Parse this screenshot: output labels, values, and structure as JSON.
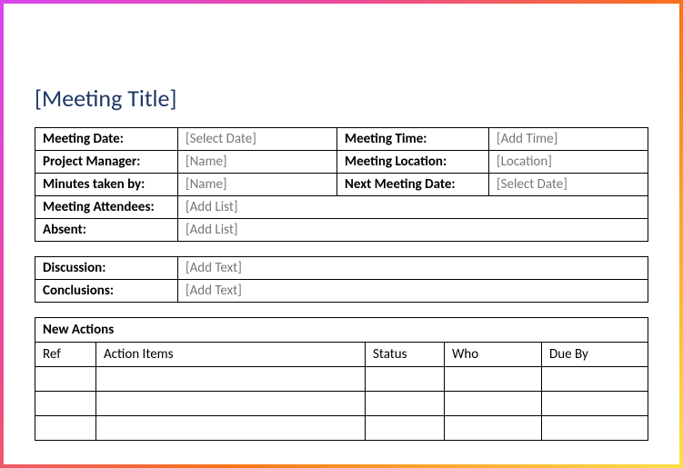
{
  "faint": {
    "line1": "",
    "line2": ""
  },
  "title": "[Meeting Title]",
  "details": {
    "meeting_date_label": "Meeting Date:",
    "meeting_date_value": "[Select Date]",
    "meeting_time_label": "Meeting Time:",
    "meeting_time_value": "[Add Time]",
    "project_manager_label": "Project Manager:",
    "project_manager_value": "[Name]",
    "meeting_location_label": "Meeting Location:",
    "meeting_location_value": "[Location]",
    "minutes_taken_by_label": "Minutes taken by:",
    "minutes_taken_by_value": "[Name]",
    "next_meeting_date_label": "Next Meeting Date:",
    "next_meeting_date_value": "[Select Date]",
    "meeting_attendees_label": "Meeting Attendees:",
    "meeting_attendees_value": "[Add List]",
    "absent_label": "Absent:",
    "absent_value": "[Add List]"
  },
  "discussion": {
    "discussion_label": "Discussion:",
    "discussion_value": "[Add Text]",
    "conclusions_label": "Conclusions:",
    "conclusions_value": "[Add Text]"
  },
  "actions": {
    "header": "New Actions",
    "cols": {
      "ref": "Ref",
      "action_items": "Action Items",
      "status": "Status",
      "who": "Who",
      "due_by": "Due By"
    }
  }
}
